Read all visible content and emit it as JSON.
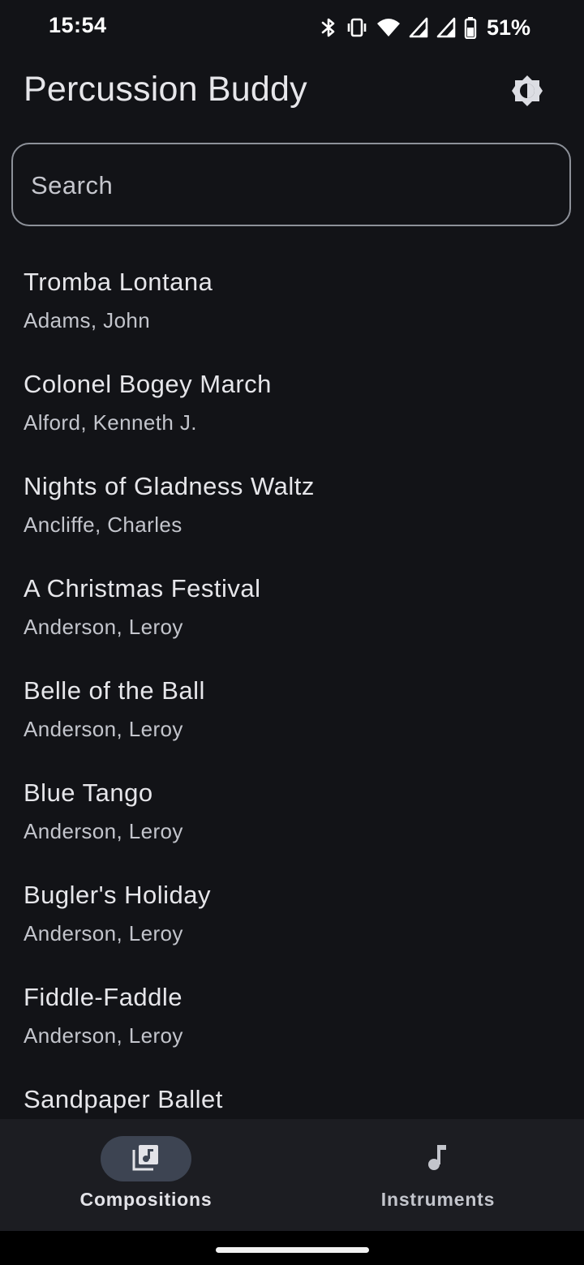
{
  "status_bar": {
    "time": "15:54",
    "battery_percent": "51%",
    "icons": [
      "bluetooth-icon",
      "vibrate-icon",
      "wifi-icon",
      "signal-icon",
      "signal-icon",
      "battery-icon"
    ]
  },
  "app_bar": {
    "title": "Percussion Buddy",
    "theme_icon": "brightness-icon"
  },
  "search": {
    "placeholder": "Search",
    "value": ""
  },
  "compositions": [
    {
      "title": "Tromba Lontana",
      "composer": "Adams, John"
    },
    {
      "title": "Colonel Bogey March",
      "composer": "Alford, Kenneth J."
    },
    {
      "title": "Nights of Gladness Waltz",
      "composer": "Ancliffe, Charles"
    },
    {
      "title": "A Christmas Festival",
      "composer": "Anderson, Leroy"
    },
    {
      "title": "Belle of the Ball",
      "composer": "Anderson, Leroy"
    },
    {
      "title": "Blue Tango",
      "composer": "Anderson, Leroy"
    },
    {
      "title": "Bugler's Holiday",
      "composer": "Anderson, Leroy"
    },
    {
      "title": "Fiddle-Faddle",
      "composer": "Anderson, Leroy"
    },
    {
      "title": "Sandpaper Ballet",
      "composer": ""
    }
  ],
  "bottom_nav": {
    "items": [
      {
        "label": "Compositions",
        "icon": "library-music-icon",
        "active": true
      },
      {
        "label": "Instruments",
        "icon": "music-note-icon",
        "active": false
      }
    ]
  },
  "colors": {
    "background": "#121317",
    "nav_background": "#1c1d22",
    "active_indicator": "#3d4452",
    "outline": "#8d9199"
  }
}
